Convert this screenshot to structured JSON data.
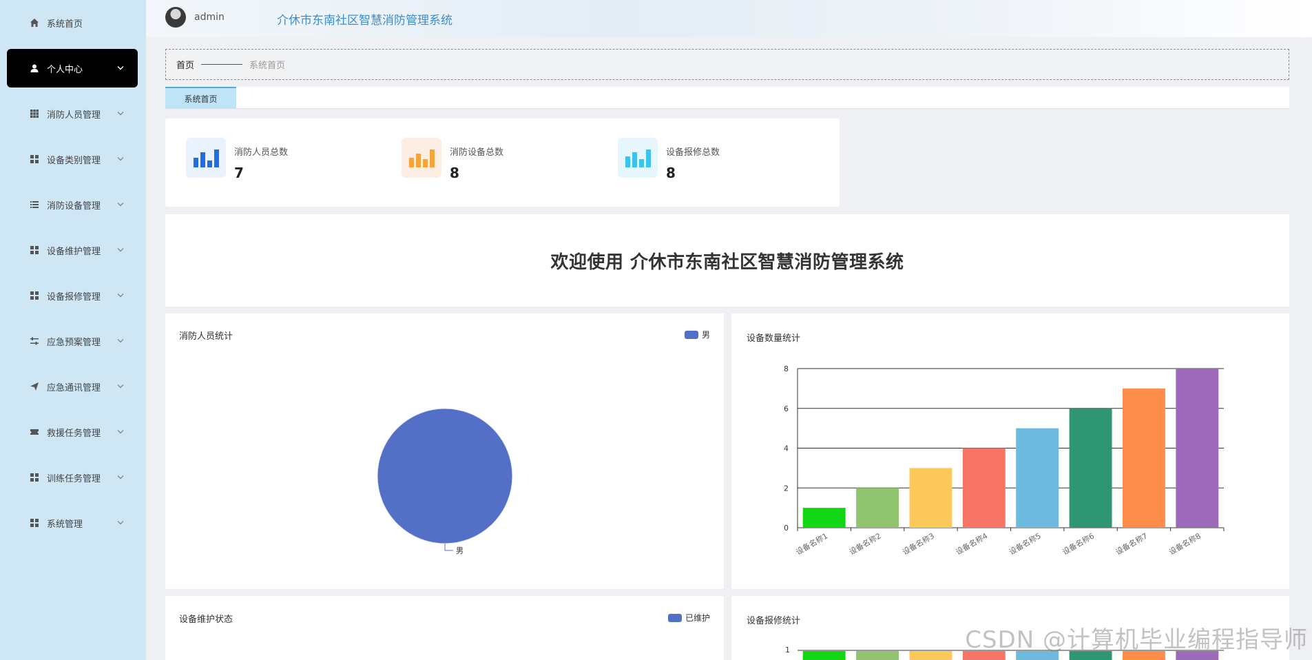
{
  "header": {
    "username": "admin",
    "app_title": "介休市东南社区智慧消防管理系统"
  },
  "sidebar": {
    "items": [
      {
        "label": "系统首页",
        "icon": "home-icon",
        "expandable": false
      },
      {
        "label": "个人中心",
        "icon": "user-icon",
        "expandable": true,
        "active": true
      },
      {
        "label": "消防人员管理",
        "icon": "grid-icon",
        "expandable": true
      },
      {
        "label": "设备类别管理",
        "icon": "grid-icon",
        "expandable": true
      },
      {
        "label": "消防设备管理",
        "icon": "list-icon",
        "expandable": true
      },
      {
        "label": "设备维护管理",
        "icon": "grid-icon",
        "expandable": true
      },
      {
        "label": "设备报修管理",
        "icon": "grid-icon",
        "expandable": true
      },
      {
        "label": "应急预案管理",
        "icon": "sliders-icon",
        "expandable": true
      },
      {
        "label": "应急通讯管理",
        "icon": "send-icon",
        "expandable": true
      },
      {
        "label": "救援任务管理",
        "icon": "ticket-icon",
        "expandable": true
      },
      {
        "label": "训练任务管理",
        "icon": "grid-icon",
        "expandable": true
      },
      {
        "label": "系统管理",
        "icon": "grid-icon",
        "expandable": true
      }
    ]
  },
  "breadcrumb": {
    "home": "首页",
    "current": "系统首页"
  },
  "tabs": [
    {
      "label": "系统首页",
      "active": true
    }
  ],
  "stats": [
    {
      "label": "消防人员总数",
      "value": "7",
      "color": "#1e6fe0",
      "bg": "#eaf3fd"
    },
    {
      "label": "消防设备总数",
      "value": "8",
      "color": "#f5a33b",
      "bg": "#fdeee3"
    },
    {
      "label": "设备报修总数",
      "value": "8",
      "color": "#3cc2ee",
      "bg": "#e6f7fd"
    }
  ],
  "welcome": {
    "text": "欢迎使用 介休市东南社区智慧消防管理系统"
  },
  "panels": {
    "personnel": {
      "title": "消防人员统计",
      "legend": "男",
      "slice_label": "男",
      "color": "#5470c6"
    },
    "device_count": {
      "title": "设备数量统计"
    },
    "maintenance": {
      "title": "设备维护状态",
      "legend": "已维护",
      "color": "#5470c6"
    },
    "repair": {
      "title": "设备报修统计",
      "axis_top_label": "1"
    }
  },
  "chart_data": [
    {
      "type": "pie",
      "title": "消防人员统计",
      "labels": [
        "男"
      ],
      "values": [
        7
      ],
      "colors": [
        "#5470c6"
      ],
      "legend": "top-right"
    },
    {
      "type": "bar",
      "title": "设备数量统计",
      "categories": [
        "设备名称1",
        "设备名称2",
        "设备名称3",
        "设备名称4",
        "设备名称5",
        "设备名称6",
        "设备名称7",
        "设备名称8"
      ],
      "values": [
        1,
        2,
        3,
        4,
        5,
        6,
        7,
        8
      ],
      "colors": [
        "#11d714",
        "#91c46f",
        "#fdc85a",
        "#f87566",
        "#6cbadd",
        "#2f9674",
        "#fe8d4c",
        "#9d6ab9"
      ],
      "ylim": [
        0,
        8
      ],
      "yticks": [
        0,
        2,
        4,
        6,
        8
      ],
      "grid": true
    }
  ],
  "watermark": "CSDN @计算机毕业编程指导师"
}
